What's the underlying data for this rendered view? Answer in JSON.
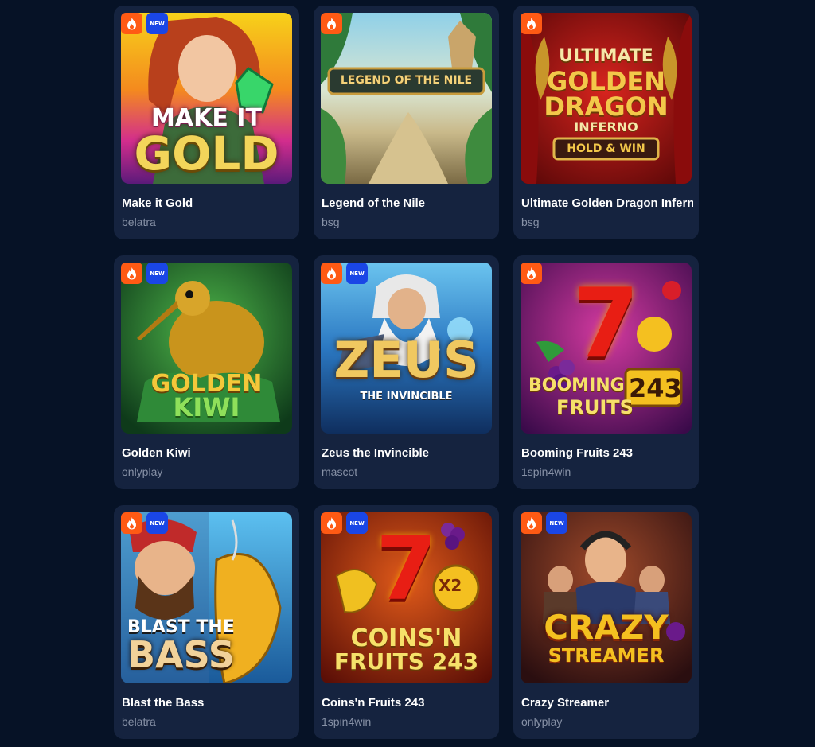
{
  "badge_new_label": "NEW",
  "games": [
    {
      "title": "Make it Gold",
      "provider": "belatra",
      "hot": true,
      "new": true,
      "logo": [
        "MAKE IT",
        "GOLD"
      ]
    },
    {
      "title": "Legend of the Nile",
      "provider": "bsg",
      "hot": true,
      "new": false,
      "logo": [
        "LEGEND OF THE NILE"
      ]
    },
    {
      "title": "Ultimate Golden Dragon Inferno",
      "provider": "bsg",
      "hot": true,
      "new": false,
      "logo": [
        "ULTIMATE",
        "GOLDEN",
        "DRAGON",
        "INFERNO",
        "HOLD & WIN"
      ]
    },
    {
      "title": "Golden Kiwi",
      "provider": "onlyplay",
      "hot": true,
      "new": true,
      "logo": [
        "GOLDEN",
        "KIWI"
      ]
    },
    {
      "title": "Zeus the Invincible",
      "provider": "mascot",
      "hot": true,
      "new": true,
      "logo": [
        "ZEUS",
        "THE INVINCIBLE"
      ]
    },
    {
      "title": "Booming Fruits 243",
      "provider": "1spin4win",
      "hot": true,
      "new": false,
      "logo": [
        "7",
        "BOOMING",
        "FRUITS",
        "243"
      ]
    },
    {
      "title": "Blast the Bass",
      "provider": "belatra",
      "hot": true,
      "new": true,
      "logo": [
        "BLAST THE",
        "BASS"
      ]
    },
    {
      "title": "Coins'n Fruits 243",
      "provider": "1spin4win",
      "hot": true,
      "new": true,
      "logo": [
        "7",
        "COINS'N",
        "FRUITS 243",
        "X2"
      ]
    },
    {
      "title": "Crazy Streamer",
      "provider": "onlyplay",
      "hot": true,
      "new": true,
      "logo": [
        "CRAZY",
        "STREAMER"
      ]
    }
  ],
  "colors": {
    "page_bg": "#061226",
    "card_bg": "#15233f",
    "hot_badge": "#ff5a14",
    "new_badge": "#1a46e6",
    "provider_text": "#8791a6"
  }
}
